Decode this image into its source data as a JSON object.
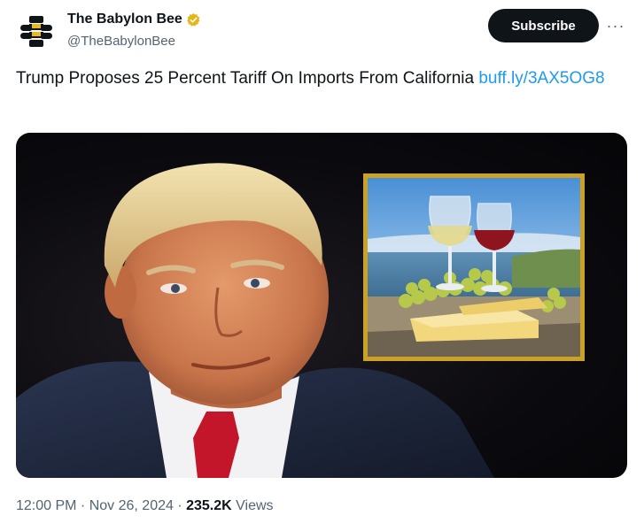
{
  "account": {
    "display_name": "The Babylon Bee",
    "handle": "@TheBabylonBee",
    "avatar_icon": "babylon-bee-logo",
    "verified_icon": "verified-badge-icon",
    "verified_color": "#e2b719"
  },
  "actions": {
    "subscribe_label": "Subscribe",
    "more_label": "···"
  },
  "tweet": {
    "text": "Trump Proposes 25 Percent Tariff On Imports From California ",
    "link_text": "buff.ly/3AX5OG8"
  },
  "meta": {
    "time": "12:00 PM",
    "sep1": " · ",
    "date": "Nov 26, 2024",
    "sep2": " · ",
    "views_count": "235.2K",
    "views_label": " Views"
  },
  "colors": {
    "link": "#1d9bf0",
    "subscribe_bg": "#0f1419",
    "muted": "#536471",
    "frame_gold": "#c9a227"
  }
}
